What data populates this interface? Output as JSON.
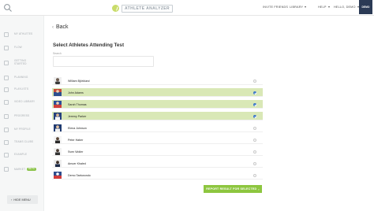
{
  "header": {
    "logo_text": "ATHLETE ANALYZER",
    "nav": {
      "invite": "INVITE FRIENDS",
      "library": "LIBRARY",
      "help": "HELP",
      "user": "HELLO, DEMO"
    },
    "avatar_label": "DEMO"
  },
  "sidebar": {
    "items": [
      {
        "label": "MY ATHLETES",
        "icon": "athletes-icon"
      },
      {
        "label": "FLOW",
        "icon": "flow-icon"
      },
      {
        "label": "GETTING STARTED",
        "icon": "getting-started-icon"
      },
      {
        "label": "PLANNING",
        "icon": "planning-icon"
      },
      {
        "label": "PLAYLISTS",
        "icon": "playlists-icon"
      },
      {
        "label": "VIDEO LIBRARY",
        "icon": "video-library-icon"
      },
      {
        "label": "PROGRESS",
        "icon": "progress-icon"
      },
      {
        "label": "MY PROFILE",
        "icon": "profile-icon"
      },
      {
        "label": "TEAMS CLUBS",
        "icon": "teams-icon"
      },
      {
        "label": "EXAMPLE",
        "icon": "example-icon"
      },
      {
        "label": "MARKET",
        "icon": "market-icon",
        "badge": "BETA"
      }
    ],
    "hide_menu": "HIDE MENU"
  },
  "main": {
    "back": "Back",
    "heading": "Select Athletes Attending Test",
    "search_label": "Search",
    "search_value": "",
    "athletes": [
      {
        "name": "William Björklund",
        "selected": false
      },
      {
        "name": "John Adams",
        "selected": true
      },
      {
        "name": "Sarah Thomas",
        "selected": true
      },
      {
        "name": "Jeremy Parker",
        "selected": true
      },
      {
        "name": "Elena Johnson",
        "selected": false
      },
      {
        "name": "Peter Haber",
        "selected": false
      },
      {
        "name": "Sven Woller",
        "selected": false
      },
      {
        "name": "Amuer Khaled",
        "selected": false
      },
      {
        "name": "Demo Taekwondo",
        "selected": false
      }
    ],
    "report_button": "REPORT RESULT FOR SELECTED"
  },
  "colors": {
    "accent_green": "#8dc63f",
    "selected_row": "#d9e8b6",
    "check_blue": "#3d78c8",
    "avatar_navy": "#2b3a55"
  }
}
